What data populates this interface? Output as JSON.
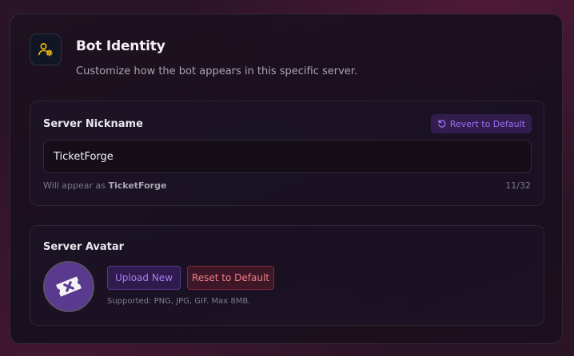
{
  "header": {
    "icon": "user-gear-icon",
    "title": "Bot Identity",
    "subtitle": "Customize how the bot appears in this specific server."
  },
  "nickname": {
    "label": "Server Nickname",
    "revert_label": "Revert to Default",
    "revert_icon": "rotate-ccw-icon",
    "value": "TicketForge",
    "hint_prefix": "Will appear as ",
    "hint_name": "TicketForge",
    "counter": "11/32"
  },
  "avatar": {
    "label": "Server Avatar",
    "image_icon": "ticket-icon",
    "upload_label": "Upload New",
    "reset_label": "Reset to Default",
    "supported": "Supported: PNG, JPG, GIF. Max 8MB."
  },
  "colors": {
    "accent_purple": "#9d6ef0",
    "danger_red": "#f07e88",
    "icon_yellow": "#f0b90b"
  }
}
